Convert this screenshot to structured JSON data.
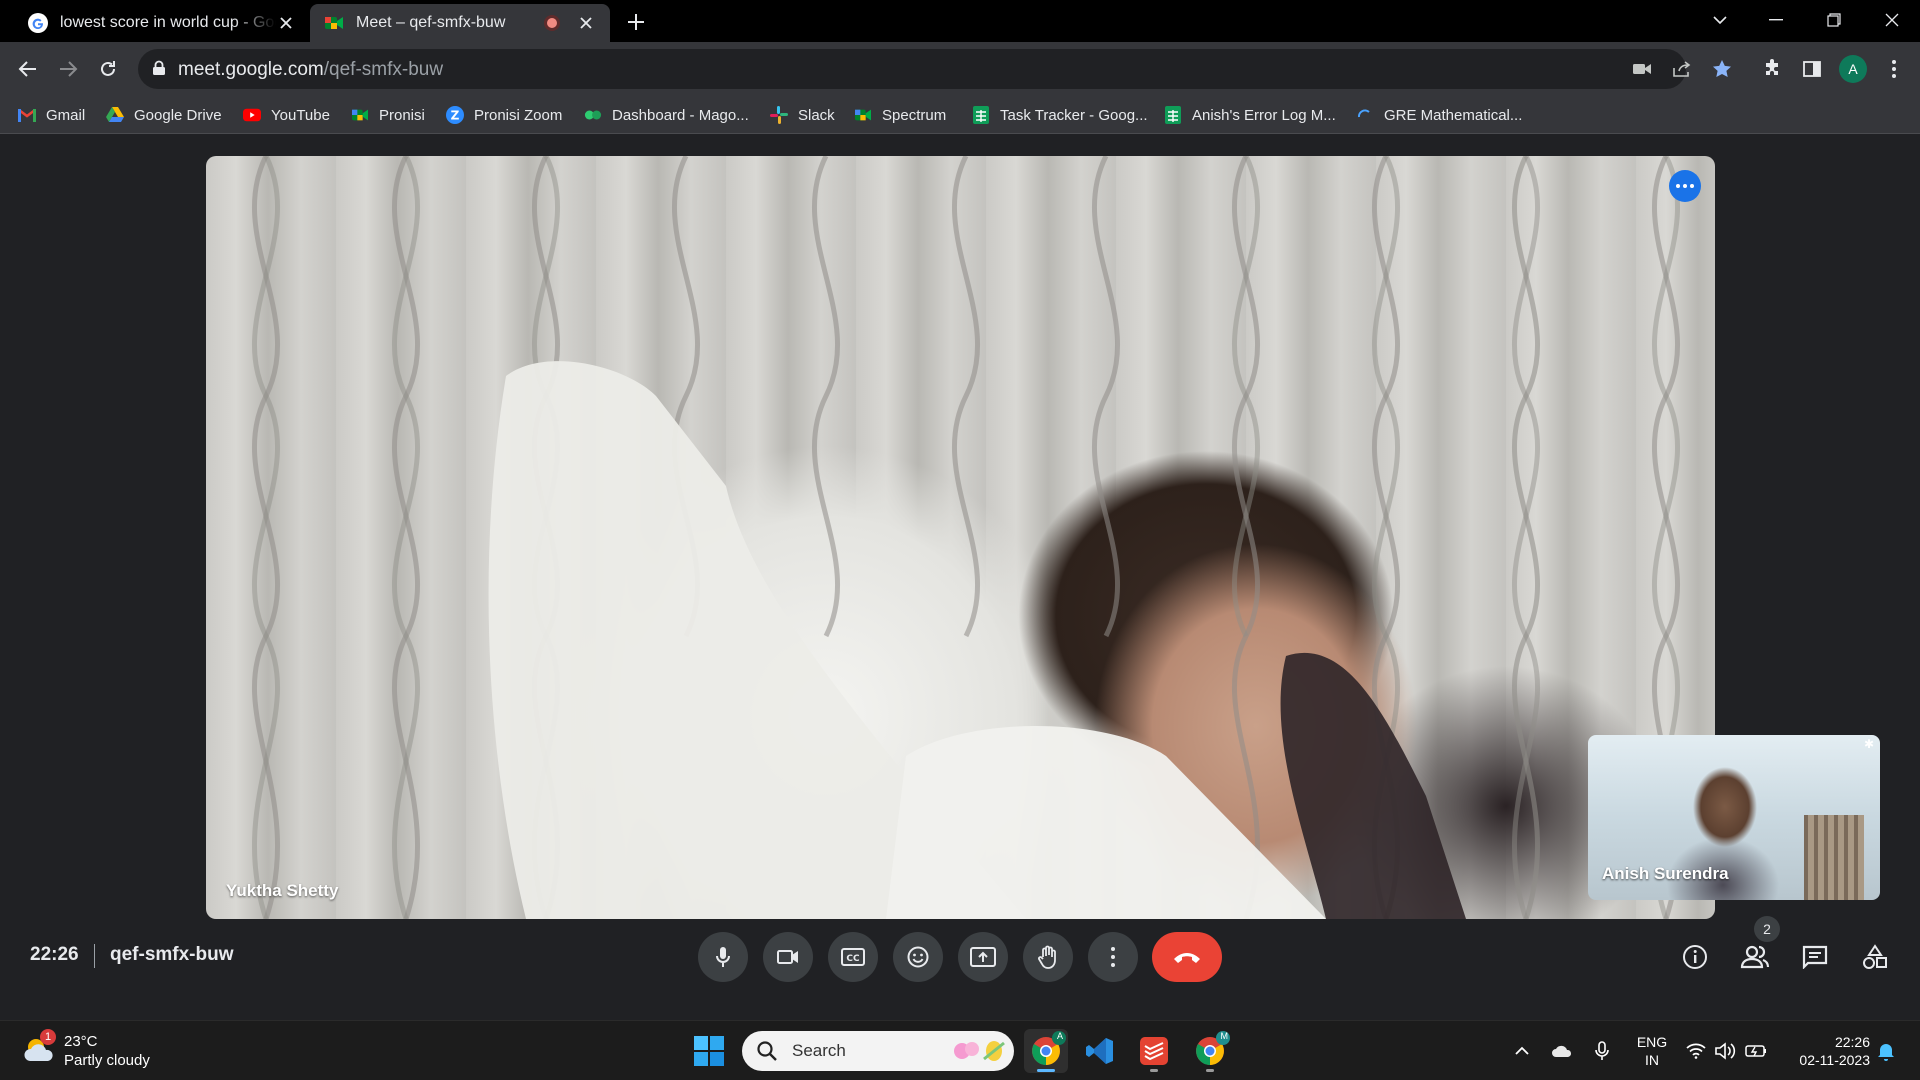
{
  "browser": {
    "tabs": [
      {
        "title": "lowest score in world cup - Google Search",
        "icon": "google-icon",
        "active": false
      },
      {
        "title": "Meet – qef-smfx-buw",
        "icon": "meet-icon",
        "active": true,
        "recording": true
      }
    ],
    "url_host": "meet.google.com",
    "url_path": "/qef-smfx-buw",
    "profile_initial": "A",
    "bookmarks": [
      {
        "label": "Gmail",
        "icon": "gmail-icon"
      },
      {
        "label": "Google Drive",
        "icon": "drive-icon"
      },
      {
        "label": "YouTube",
        "icon": "youtube-icon"
      },
      {
        "label": "Pronisi",
        "icon": "meet-icon"
      },
      {
        "label": "Pronisi Zoom",
        "icon": "zoom-icon"
      },
      {
        "label": "Dashboard - Mago...",
        "icon": "dashboard-icon"
      },
      {
        "label": "Slack",
        "icon": "slack-icon"
      },
      {
        "label": "Spectrum",
        "icon": "meet-icon"
      },
      {
        "label": "Task Tracker - Goog...",
        "icon": "sheets-icon"
      },
      {
        "label": "Anish's Error Log M...",
        "icon": "sheets-icon"
      },
      {
        "label": "GRE Mathematical...",
        "icon": "loading-icon"
      }
    ]
  },
  "meet": {
    "main_participant": "Yuktha Shetty",
    "self_participant": "Anish Surendra",
    "time": "22:26",
    "meeting_code": "qef-smfx-buw",
    "participant_count": "2",
    "controls": [
      "microphone",
      "camera",
      "captions",
      "reactions",
      "present",
      "raise-hand",
      "more-options",
      "leave-call"
    ],
    "right_controls": [
      "meeting-details",
      "people",
      "chat",
      "activities"
    ],
    "accent_color": "#1a73e8",
    "hangup_color": "#ea4335"
  },
  "taskbar": {
    "weather_temp": "23°C",
    "weather_condition": "Partly cloudy",
    "weather_badge": "1",
    "search_placeholder": "Search",
    "language_line1": "ENG",
    "language_line2": "IN",
    "clock_time": "22:26",
    "clock_date": "02-11-2023",
    "chrome_badge": "A",
    "chrome2_badge": "M"
  }
}
